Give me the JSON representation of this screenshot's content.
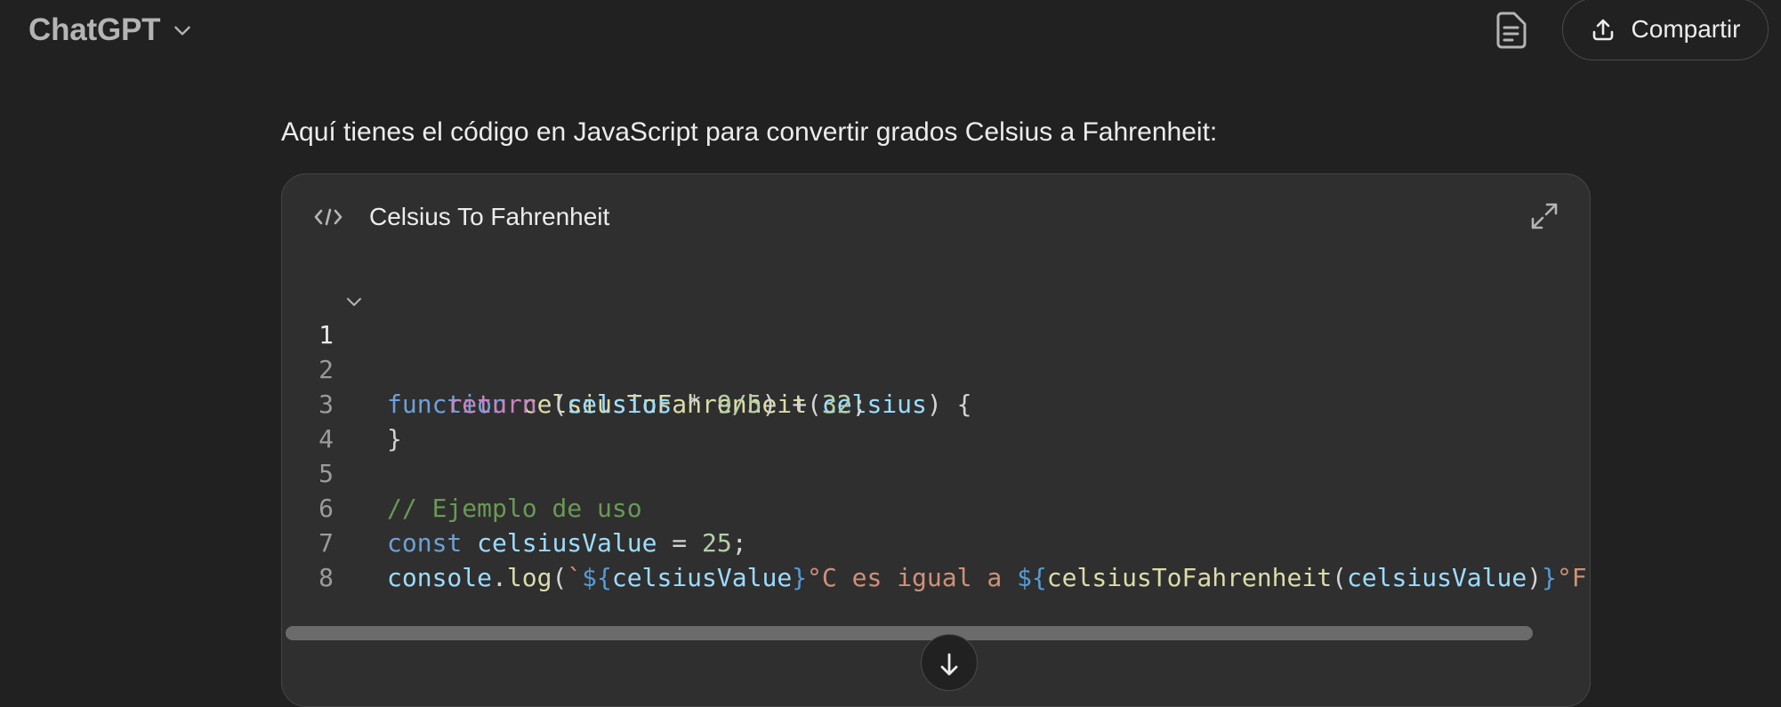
{
  "header": {
    "model_name": "ChatGPT",
    "share_label": "Compartir"
  },
  "message": {
    "intro": "Aquí tienes el código en JavaScript para convertir grados Celsius a Fahrenheit:"
  },
  "code_block": {
    "title": "Celsius To Fahrenheit",
    "line_numbers": [
      "1",
      "2",
      "3",
      "4",
      "5",
      "6",
      "7",
      "8"
    ],
    "tokens": {
      "l1_kw": "function",
      "l1_fn": "celsiusToFahrenheit",
      "l1_p1": "(",
      "l1_arg": "celsius",
      "l1_p2": ") {",
      "l2_indent": "    ",
      "l2_kw": "return",
      "l2_p1": " (",
      "l2_var": "celsius",
      "l2_op": " * ",
      "l2_num1": "9/5",
      "l2_p2": ") + ",
      "l2_num2": "32",
      "l2_p3": ";",
      "l3": "}",
      "l5": "// Ejemplo de uso",
      "l6_kw": "const",
      "l6_var": "celsiusValue",
      "l6_op": " = ",
      "l6_num": "25",
      "l6_end": ";",
      "l7_obj": "console",
      "l7_dot": ".",
      "l7_fn": "log",
      "l7_p1": "(",
      "l7_bt": "`",
      "l7_t1": "${",
      "l7_v1": "celsiusValue",
      "l7_t2": "}",
      "l7_s1": "°C es igual a ",
      "l7_t3": "${",
      "l7_fn2": "celsiusToFahrenheit",
      "l7_p2": "(",
      "l7_v2": "celsiusValue",
      "l7_p3": ")",
      "l7_t4": "}",
      "l7_s2": "°F"
    }
  },
  "icons": {
    "model_dropdown": "chevron-down-icon",
    "document": "document-icon",
    "share": "share-upload-icon",
    "code": "code-icon",
    "expand": "expand-icon",
    "fold": "chevron-down-icon",
    "scroll_down": "arrow-down-icon"
  },
  "colors": {
    "background": "#212121",
    "card": "#2f2f2f",
    "keyword": "#6ea0d8",
    "function": "#dcdcaa",
    "variable": "#9cdcfe",
    "return_keyword": "#c586c0",
    "number": "#b5cea8",
    "comment": "#6a9955",
    "string": "#ce9178"
  }
}
